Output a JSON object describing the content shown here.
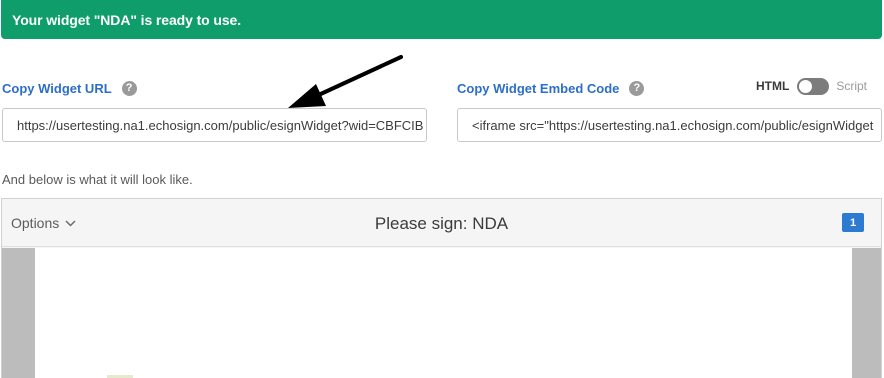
{
  "banner": {
    "message": "Your widget \"NDA\" is ready to use."
  },
  "url_section": {
    "label": "Copy Widget URL",
    "help": "?",
    "value": "https://usertesting.na1.echosign.com/public/esignWidget?wid=CBFCIB"
  },
  "embed_section": {
    "label": "Copy Widget Embed Code",
    "help": "?",
    "value": "<iframe src=\"https://usertesting.na1.echosign.com/public/esignWidget",
    "toggle": {
      "left_label": "HTML",
      "right_label": "Script",
      "selected": "HTML"
    }
  },
  "preview_intro": "And below is what it will look like.",
  "preview": {
    "options_label": "Options",
    "title": "Please sign: NDA",
    "page_count": "1"
  },
  "colors": {
    "banner": "#0e9d6b",
    "link_label": "#2d6ec8",
    "badge": "#2d7bd0"
  },
  "icons": [
    "help-icon",
    "chevron-down-icon",
    "arrow-annotation"
  ]
}
